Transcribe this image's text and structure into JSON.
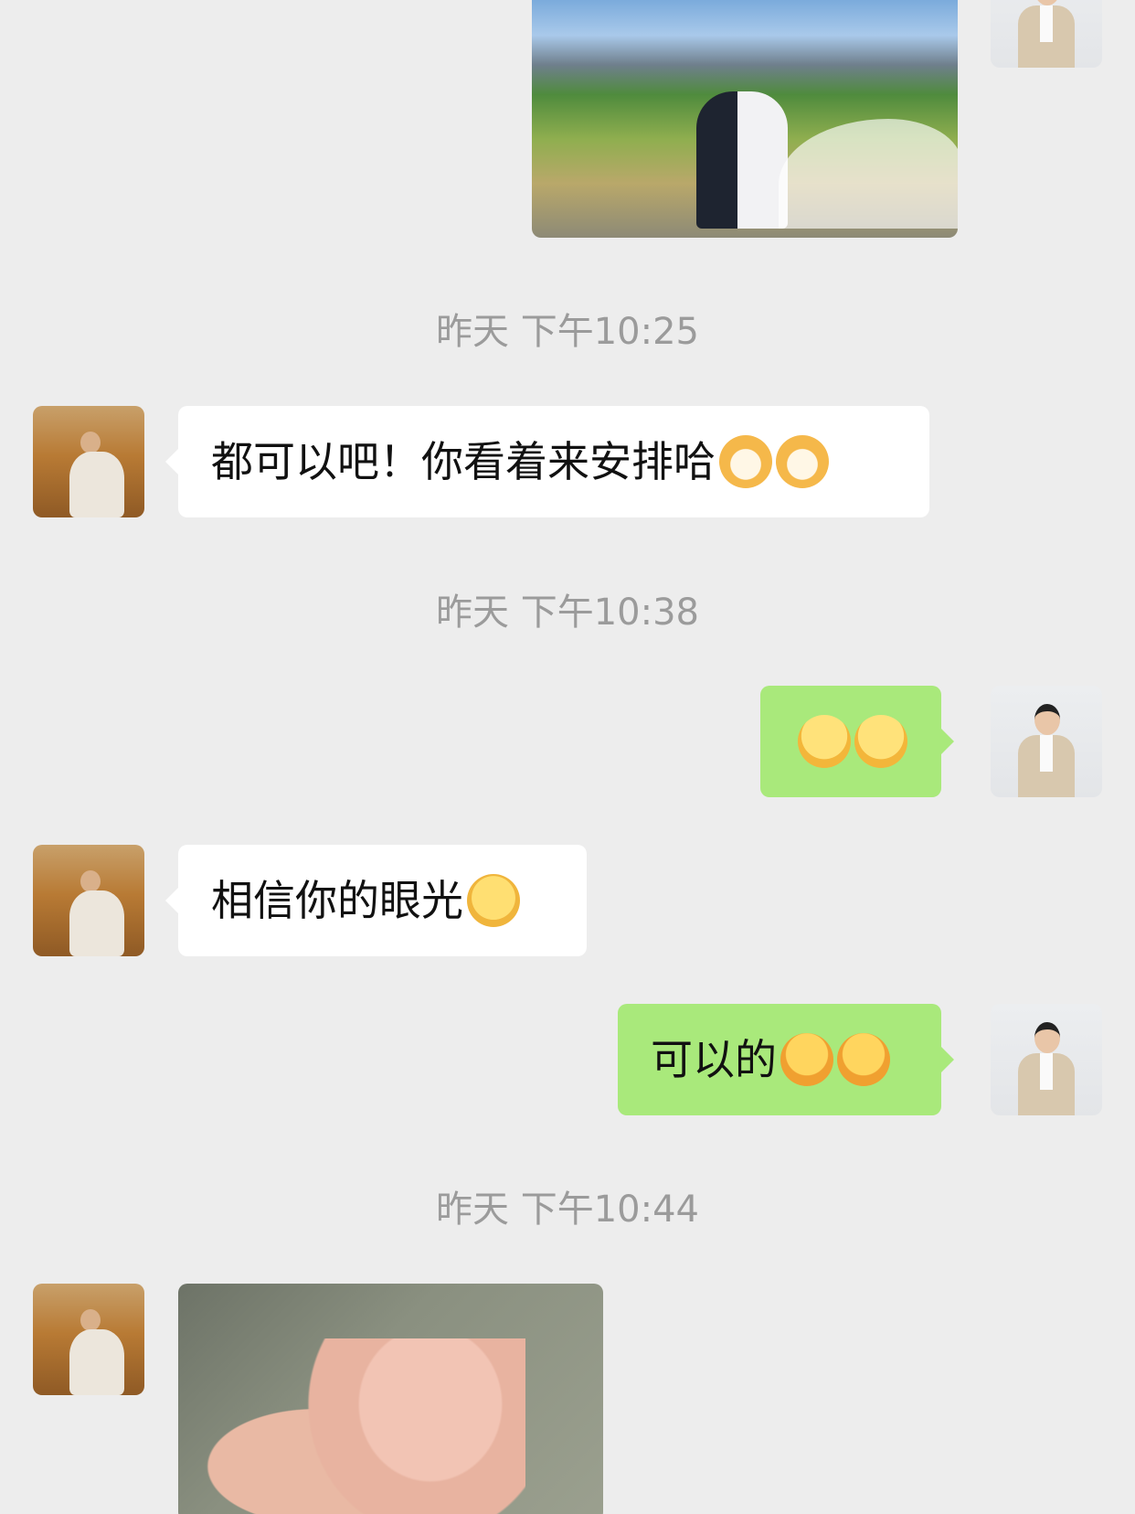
{
  "timestamps": [
    "昨天 下午10:25",
    "昨天 下午10:38",
    "昨天 下午10:44"
  ],
  "messages": [
    {
      "from": "me",
      "type": "image",
      "content": "wedding-photo"
    },
    {
      "from": "other",
      "type": "text",
      "text": "都可以吧！你看着来安排哈",
      "emojis": [
        "cat-emoji",
        "cat-emoji"
      ]
    },
    {
      "from": "me",
      "type": "emoji",
      "emojis": [
        "grin-emoji",
        "grin-emoji"
      ]
    },
    {
      "from": "other",
      "type": "text",
      "text": "相信你的眼光",
      "emojis": [
        "thinking-emoji"
      ]
    },
    {
      "from": "me",
      "type": "text",
      "text": "可以的",
      "emojis": [
        "cover-mouth-emoji",
        "cover-mouth-emoji"
      ]
    },
    {
      "from": "other",
      "type": "image",
      "content": "thumbs-up-photo"
    }
  ],
  "colors": {
    "background": "#ededed",
    "bubble_me": "#a9e97b",
    "bubble_other": "#ffffff",
    "timestamp": "#9b9b9b"
  }
}
